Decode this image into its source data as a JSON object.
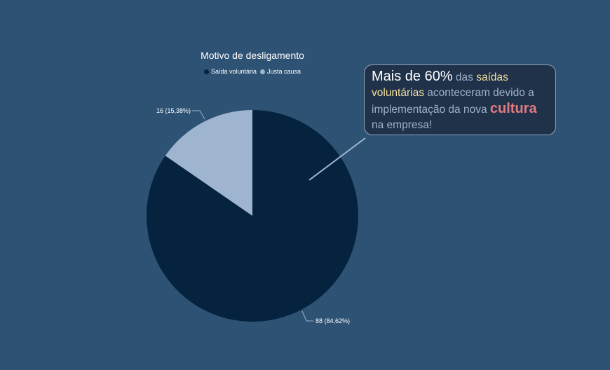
{
  "chart_data": {
    "type": "pie",
    "title": "Motivo de desligamento",
    "categories": [
      "Saída voluntária",
      "Justa causa"
    ],
    "values": [
      88,
      16
    ],
    "percentages": [
      "84,62%",
      "15,38%"
    ],
    "data_labels": [
      "88 (84,62%)",
      "16 (15,38%)"
    ],
    "colors": [
      "#05223f",
      "#9fb4ce"
    ],
    "legend_position": "top"
  },
  "annotation": {
    "part1": "Mais de 60%",
    "part2": " das ",
    "part3": "saídas voluntárias",
    "part4": " aconteceram devido a implementação da nova ",
    "part5": "cultura",
    "part6": " na empresa!"
  },
  "colors": {
    "background": "#2e5274",
    "callout_background": "#1f324a",
    "callout_border": "#8ea3bb",
    "highlight_yellow": "#f3df9c",
    "highlight_red": "#e07a80"
  }
}
